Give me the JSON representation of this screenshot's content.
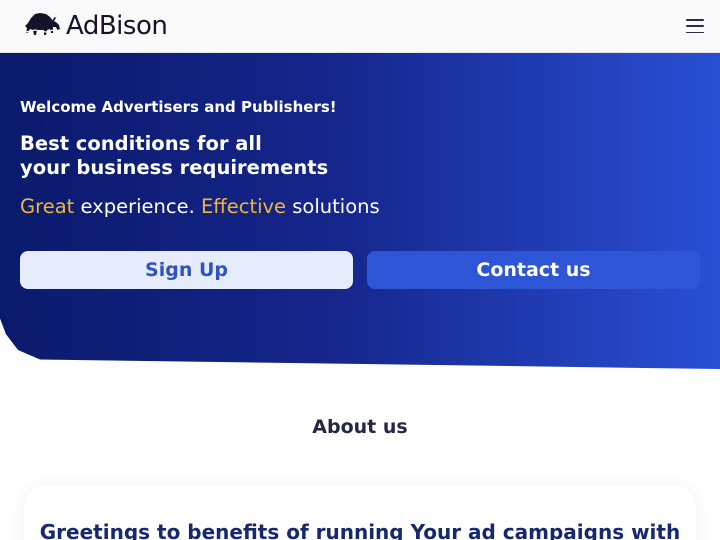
{
  "header": {
    "brand": "AdBison",
    "menu_icon": "hamburger-menu-icon"
  },
  "hero": {
    "eyebrow": "Welcome Advertisers and Publishers!",
    "title_line1": "Best conditions for all",
    "title_line2": "your business requirements",
    "tagline": {
      "word1": "Great",
      "text1": " experience. ",
      "word2": "Effective",
      "text2": " solutions"
    },
    "buttons": {
      "signup": "Sign Up",
      "contact": "Contact us"
    }
  },
  "about": {
    "title": "About us",
    "card_heading": "Greetings to benefits of running Your ad campaigns with"
  },
  "colors": {
    "hero_gradient_start": "#0a1a6b",
    "hero_gradient_end": "#2a4fd4",
    "accent": "#f2b636",
    "signup_bg": "#e6ecfb",
    "contact_bg": "#2e55d6",
    "brand_dark": "#12142b"
  }
}
